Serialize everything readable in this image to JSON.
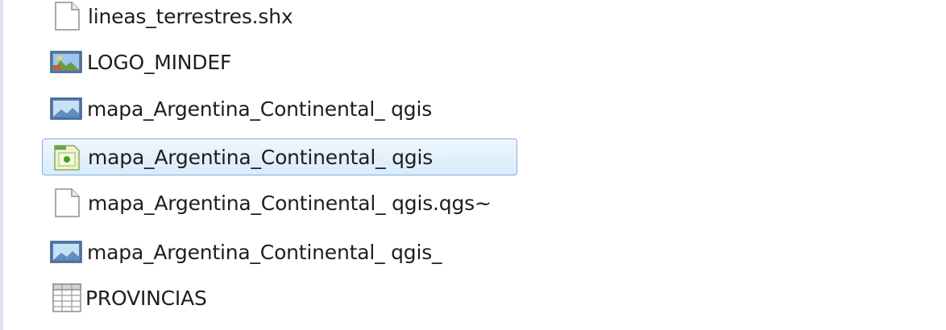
{
  "files": [
    {
      "name": "lineas_terrestres.shx",
      "icon": "blank-document-icon"
    },
    {
      "name": "LOGO_MINDEF",
      "icon": "image-file-icon"
    },
    {
      "name": "mapa_Argentina_Continental_ qgis",
      "icon": "image-file-icon"
    },
    {
      "name": "mapa_Argentina_Continental_ qgis",
      "icon": "qgis-project-icon",
      "selected": true
    },
    {
      "name": "mapa_Argentina_Continental_ qgis.qgs~",
      "icon": "blank-document-icon"
    },
    {
      "name": "mapa_Argentina_Continental_ qgis_",
      "icon": "image-file-icon"
    },
    {
      "name": "PROVINCIAS",
      "icon": "table-file-icon"
    }
  ],
  "colors": {
    "selection_border": "#84acdd",
    "selection_fill": "#d9ebfb",
    "left_border": "#dbe4ee"
  }
}
